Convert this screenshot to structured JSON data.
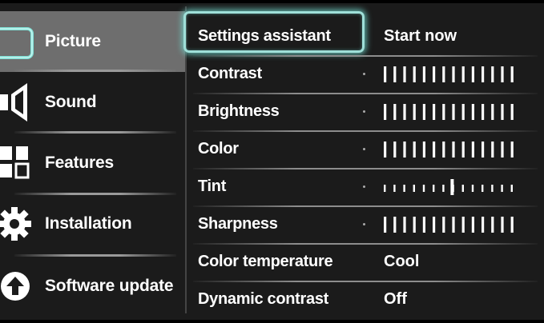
{
  "sidebar": {
    "items": [
      {
        "label": "Picture",
        "icon": "picture-icon",
        "selected": true
      },
      {
        "label": "Sound",
        "icon": "speaker-icon",
        "selected": false
      },
      {
        "label": "Features",
        "icon": "features-icon",
        "selected": false
      },
      {
        "label": "Installation",
        "icon": "gear-icon",
        "selected": false
      },
      {
        "label": "Software update",
        "icon": "upload-icon",
        "selected": false
      }
    ]
  },
  "settings": {
    "rows": [
      {
        "label": "Settings assistant",
        "value": "Start now",
        "focused": true
      },
      {
        "label": "Contrast",
        "slider": {
          "level": 1.0,
          "style": "full"
        }
      },
      {
        "label": "Brightness",
        "slider": {
          "level": 1.0,
          "style": "full"
        }
      },
      {
        "label": "Color",
        "slider": {
          "level": 1.0,
          "style": "full"
        }
      },
      {
        "label": "Tint",
        "slider": {
          "level": 0.5,
          "style": "center"
        }
      },
      {
        "label": "Sharpness",
        "slider": {
          "level": 1.0,
          "style": "full"
        }
      },
      {
        "label": "Color temperature",
        "value": "Cool"
      },
      {
        "label": "Dynamic contrast",
        "value": "Off"
      }
    ]
  },
  "colors": {
    "background": "#1b1b1b",
    "sidebar_selected": "#6e6e6e",
    "focus_glow": "#9fe0d9",
    "text": "#ffffff"
  }
}
